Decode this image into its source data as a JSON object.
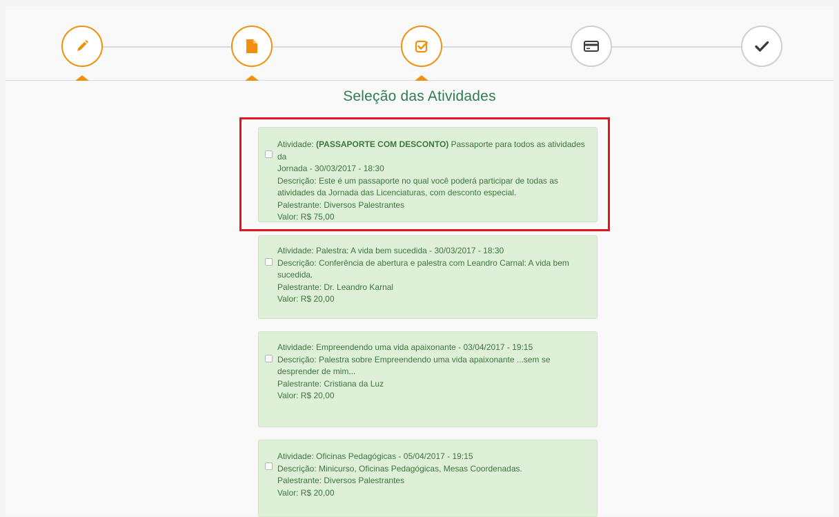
{
  "stepper": {
    "steps": [
      {
        "icon": "pencil-icon",
        "state": "done"
      },
      {
        "icon": "document-icon",
        "state": "done"
      },
      {
        "icon": "checkbox-icon",
        "state": "done"
      },
      {
        "icon": "credit-card-icon",
        "state": "todo"
      },
      {
        "icon": "checkmark-icon",
        "state": "todo"
      }
    ],
    "accent_color": "#f0900e",
    "inactive_color": "#cfcfcf"
  },
  "page_title": "Seleção das Atividades",
  "activities": [
    {
      "label": "Atividade:",
      "name_bold": "(PASSAPORTE COM DESCONTO)",
      "name_rest": "Passaporte para todos as atividades da",
      "name_line2": "Jornada - 30/03/2017 - 18:30",
      "desc_line1": "Descrição: Este é um passaporte no qual você poderá participar de todas as",
      "desc_line2": "atividades da Jornada das Licenciaturas, com desconto especial.",
      "speaker": "Palestrante: Diversos Palestrantes",
      "price": "Valor: R$ 75,00",
      "checked": false
    },
    {
      "line1": "Atividade: Palestra: A vida bem sucedida - 30/03/2017 - 18:30",
      "desc_line1": "Descrição: Conferência de abertura e palestra com Leandro Carnal: A vida bem",
      "desc_line2": "sucedida.",
      "speaker": "Palestrante: Dr. Leandro Karnal",
      "price": "Valor: R$ 20,00",
      "checked": false
    },
    {
      "line1": "Atividade: Empreendendo uma vida apaixonante - 03/04/2017 - 19:15",
      "desc_line1": "Descrição: Palestra sobre Empreendendo uma vida apaixonante ...sem se",
      "desc_line2": "desprender de mim...",
      "speaker": "Palestrante: Cristiana da Luz",
      "price": "Valor: R$ 20,00",
      "checked": false
    },
    {
      "line1": "Atividade: Oficinas Pedagógicas - 05/04/2017 - 19:15",
      "desc_line1": "Descrição: Minicurso, Oficinas Pedagógicas, Mesas Coordenadas.",
      "speaker": "Palestrante: Diversos Palestrantes",
      "price": "Valor: R$ 20,00",
      "checked": false
    }
  ],
  "colors": {
    "card_bg": "#dff0d8",
    "card_text": "#3c763d",
    "title": "#2e7d4f",
    "highlight": "#e4141e"
  }
}
